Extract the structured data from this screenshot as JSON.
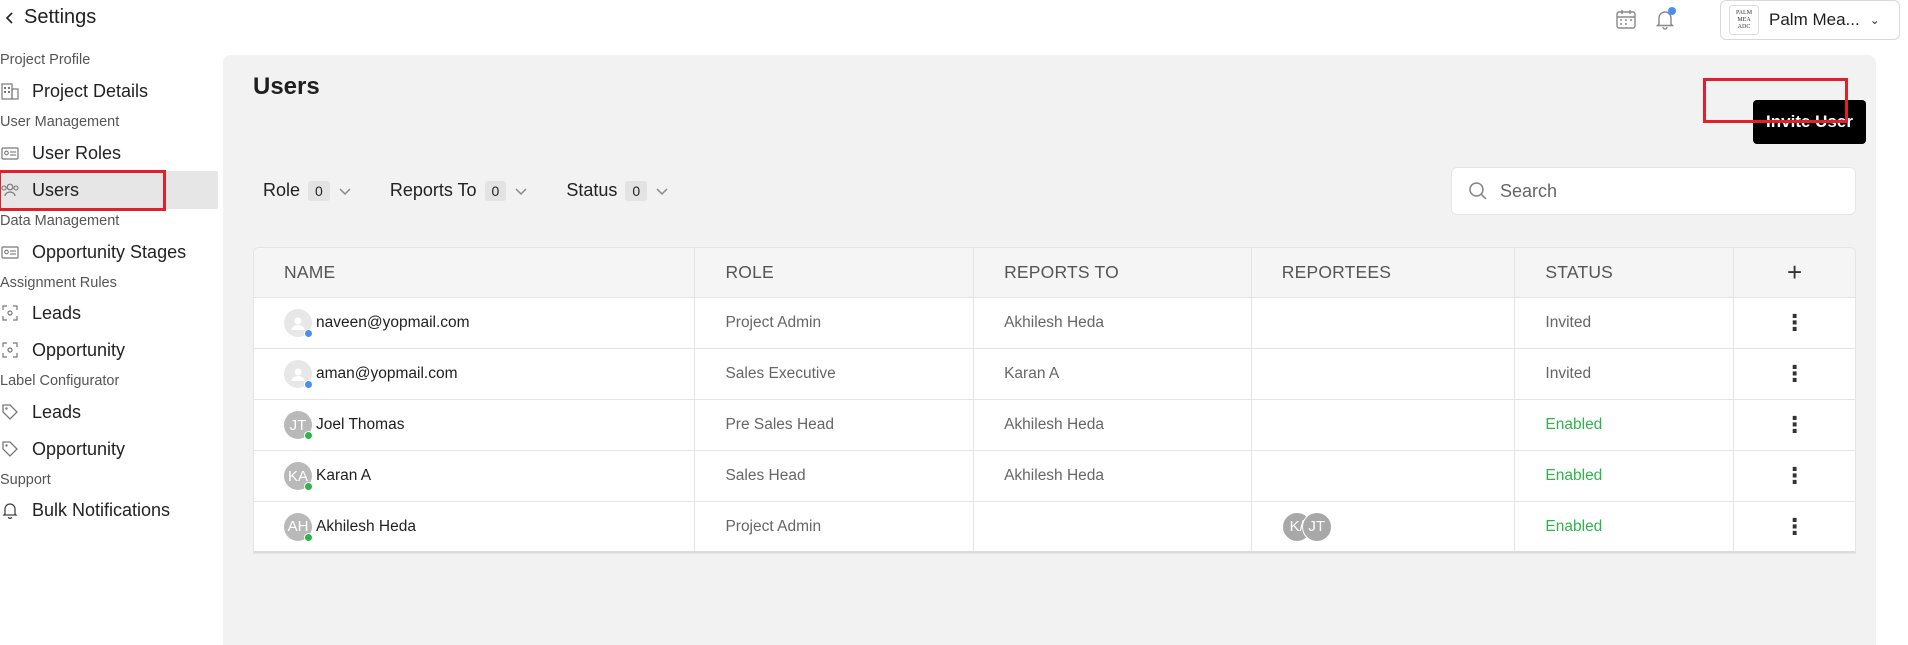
{
  "header": {
    "back_label": "Settings",
    "org_name": "Palm Mea...",
    "org_logo_lines": [
      "PALM",
      "MEA",
      "ADC"
    ]
  },
  "sidebar": {
    "sections": [
      {
        "label": "Project Profile",
        "items": [
          {
            "label": "Project Details",
            "icon": "building-icon"
          }
        ]
      },
      {
        "label": "User Management",
        "items": [
          {
            "label": "User Roles",
            "icon": "id-card-icon"
          },
          {
            "label": "Users",
            "icon": "users-icon",
            "active": true
          }
        ]
      },
      {
        "label": "Data Management",
        "items": [
          {
            "label": "Opportunity Stages",
            "icon": "id-card-icon"
          }
        ]
      },
      {
        "label": "Assignment Rules",
        "items": [
          {
            "label": "Leads",
            "icon": "target-icon"
          },
          {
            "label": "Opportunity",
            "icon": "target-icon"
          }
        ]
      },
      {
        "label": "Label Configurator",
        "items": [
          {
            "label": "Leads",
            "icon": "tag-icon"
          },
          {
            "label": "Opportunity",
            "icon": "tag-icon"
          }
        ]
      },
      {
        "label": "Support",
        "items": [
          {
            "label": "Bulk Notifications",
            "icon": "bell-icon"
          }
        ]
      }
    ]
  },
  "main": {
    "title": "Users",
    "invite_label": "Invite User",
    "filters": [
      {
        "label": "Role",
        "count": "0"
      },
      {
        "label": "Reports To",
        "count": "0"
      },
      {
        "label": "Status",
        "count": "0"
      }
    ],
    "search_placeholder": "Search"
  },
  "table": {
    "columns": [
      "NAME",
      "ROLE",
      "REPORTS TO",
      "REPORTEES",
      "STATUS"
    ],
    "rows": [
      {
        "name": "naveen@yopmail.com",
        "initials": "",
        "status_dot": "#4a8ef0",
        "role": "Project Admin",
        "reports_to": "Akhilesh Heda",
        "reportees": [],
        "status": "Invited"
      },
      {
        "name": "aman@yopmail.com",
        "initials": "",
        "status_dot": "#4a8ef0",
        "role": "Sales Executive",
        "reports_to": "Karan A",
        "reportees": [],
        "status": "Invited"
      },
      {
        "name": "Joel Thomas",
        "initials": "JT",
        "status_dot": "#2fb34a",
        "role": "Pre Sales Head",
        "reports_to": "Akhilesh Heda",
        "reportees": [],
        "status": "Enabled"
      },
      {
        "name": "Karan A",
        "initials": "KA",
        "status_dot": "#2fb34a",
        "role": "Sales Head",
        "reports_to": "Akhilesh Heda",
        "reportees": [],
        "status": "Enabled"
      },
      {
        "name": "Akhilesh Heda",
        "initials": "AH",
        "status_dot": "#2fb34a",
        "role": "Project Admin",
        "reports_to": "",
        "reportees": [
          "K/",
          "JT"
        ],
        "status": "Enabled"
      }
    ]
  },
  "colors": {
    "highlight_box": "#e0202a",
    "enabled": "#2fb34a",
    "invited_dot": "#4a8ef0"
  }
}
